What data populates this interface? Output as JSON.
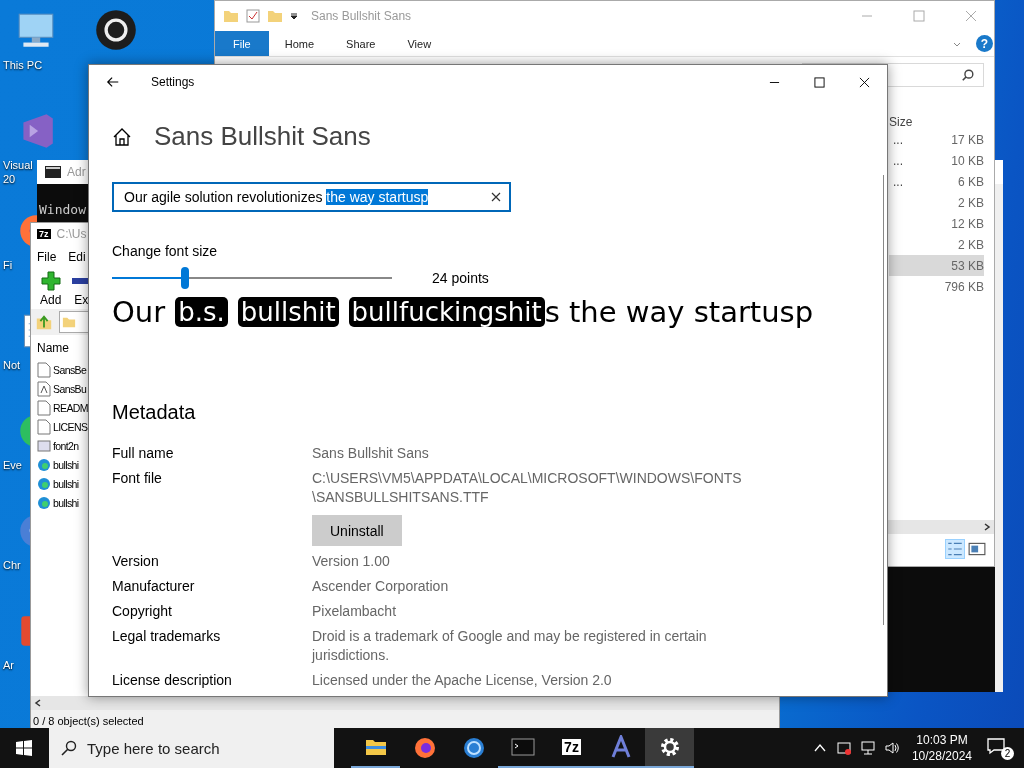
{
  "desktop_icons": [
    {
      "kind": "pc",
      "lines": [
        "This PC"
      ]
    },
    {
      "kind": "vs",
      "lines": [
        "Visual",
        "20"
      ]
    },
    {
      "kind": "firefox",
      "lines": [
        "Fi"
      ]
    },
    {
      "kind": "notepad",
      "lines": [
        "Not"
      ]
    },
    {
      "kind": "evernote",
      "lines": [
        "Eve"
      ]
    },
    {
      "kind": "chrome",
      "lines": [
        "Chr"
      ]
    },
    {
      "kind": "acrobat",
      "lines": [
        "Ar"
      ]
    }
  ],
  "desktop_icon_2": {
    "kind": "obs"
  },
  "console_window": {
    "title": "Adr",
    "text": "Window"
  },
  "explorer_window": {
    "title": "Sans Bullshit Sans",
    "ribbon_tabs": [
      {
        "label": "File",
        "selected": true
      },
      {
        "label": "Home",
        "selected": false
      },
      {
        "label": "Share",
        "selected": false
      },
      {
        "label": "View",
        "selected": false
      }
    ],
    "help": "?",
    "size_header": "Size",
    "rows": [
      {
        "cut": "...",
        "size": "17 KB",
        "selected": false
      },
      {
        "cut": "...",
        "size": "10 KB",
        "selected": false
      },
      {
        "cut": "...",
        "size": "6 KB",
        "selected": false
      },
      {
        "size": "2 KB",
        "selected": false
      },
      {
        "size": "12 KB",
        "selected": false
      },
      {
        "size": "2 KB",
        "selected": false
      },
      {
        "size": "53 KB",
        "selected": true
      },
      {
        "size": "796 KB",
        "selected": false
      }
    ]
  },
  "sevenzip_window": {
    "icon_glyph": "7z",
    "title": "C:\\Us",
    "menu": [
      "File",
      "Edi"
    ],
    "toolbar": [
      "Add",
      "Ex"
    ],
    "name_header": "Name",
    "files": [
      {
        "kind": "doc",
        "name": "SansBe"
      },
      {
        "kind": "font",
        "name": "SansBu"
      },
      {
        "kind": "doc",
        "name": "READM"
      },
      {
        "kind": "doc",
        "name": "LICENS"
      },
      {
        "kind": "exe",
        "name": "font2n"
      },
      {
        "kind": "web",
        "name": "bullshi"
      },
      {
        "kind": "web",
        "name": "bullshi"
      },
      {
        "kind": "web",
        "name": "bullshi"
      }
    ],
    "status": "0 / 8 object(s) selected"
  },
  "settings_window": {
    "title": "Settings",
    "heading": "Sans Bullshit Sans",
    "sample_field": {
      "parts": [
        {
          "text": "Our agile solution revolutionizes ",
          "selected": false
        },
        {
          "text": "the way startusp",
          "selected": true
        }
      ]
    },
    "size_label": "Change font size",
    "size_slider": {
      "level": 0.26
    },
    "size_reading": "24 points",
    "preview": [
      {
        "kind": "plain",
        "text": "Our"
      },
      {
        "kind": "badge",
        "text": "b.s."
      },
      {
        "kind": "badge",
        "text": "bullshit"
      },
      {
        "kind": "badge",
        "text": "bullfuckingshit"
      },
      {
        "kind": "plain",
        "text": "s the way startusp"
      }
    ],
    "metadata_title": "Metadata",
    "metadata": [
      {
        "label": "Full name",
        "value": "Sans Bullshit Sans"
      },
      {
        "label": "Font file",
        "value": "C:\\USERS\\VM5\\APPDATA\\LOCAL\\MICROSOFT\\WINDOWS\\FONTS\n\\SANSBULLSHITSANS.TTF",
        "button": "Uninstall"
      },
      {
        "label": "Version",
        "value": "Version 1.00"
      },
      {
        "label": "Manufacturer",
        "value": "Ascender Corporation"
      },
      {
        "label": "Copyright",
        "value": "Pixelambacht"
      },
      {
        "label": "Legal trademarks",
        "value": "Droid is a trademark of Google and may be registered in certain\njurisdictions."
      },
      {
        "label": "License description",
        "value": "Licensed under the Apache License, Version 2.0"
      }
    ]
  },
  "taskbar": {
    "search_placeholder": "Type here to search",
    "apps": [
      {
        "kind": "explorer",
        "running": true,
        "selected": false
      },
      {
        "kind": "firefox",
        "running": false,
        "selected": false
      },
      {
        "kind": "chrome",
        "running": false,
        "selected": false
      },
      {
        "kind": "terminal",
        "running": true,
        "selected": false
      },
      {
        "kind": "sevenzip",
        "glyph": "7z",
        "running": true,
        "selected": false
      },
      {
        "kind": "fontforge",
        "running": true,
        "selected": false
      },
      {
        "kind": "settings",
        "running": true,
        "selected": true
      }
    ],
    "time": "10:03 PM",
    "date": "10/28/2024",
    "notifications": "2"
  }
}
